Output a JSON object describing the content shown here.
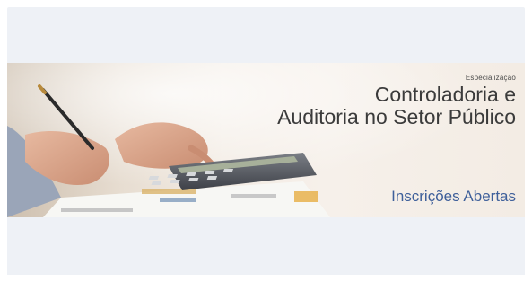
{
  "banner": {
    "eyebrow": "Especialização",
    "title_line1": "Controladoria e",
    "title_line2": "Auditoria no Setor Público",
    "cta": "Inscrições Abertas"
  },
  "colors": {
    "cta": "#3e5f9a",
    "title": "#3b3b3b",
    "panel": "#eef1f6"
  },
  "illustration": {
    "subject": "hand-with-pen-and-calculator"
  }
}
